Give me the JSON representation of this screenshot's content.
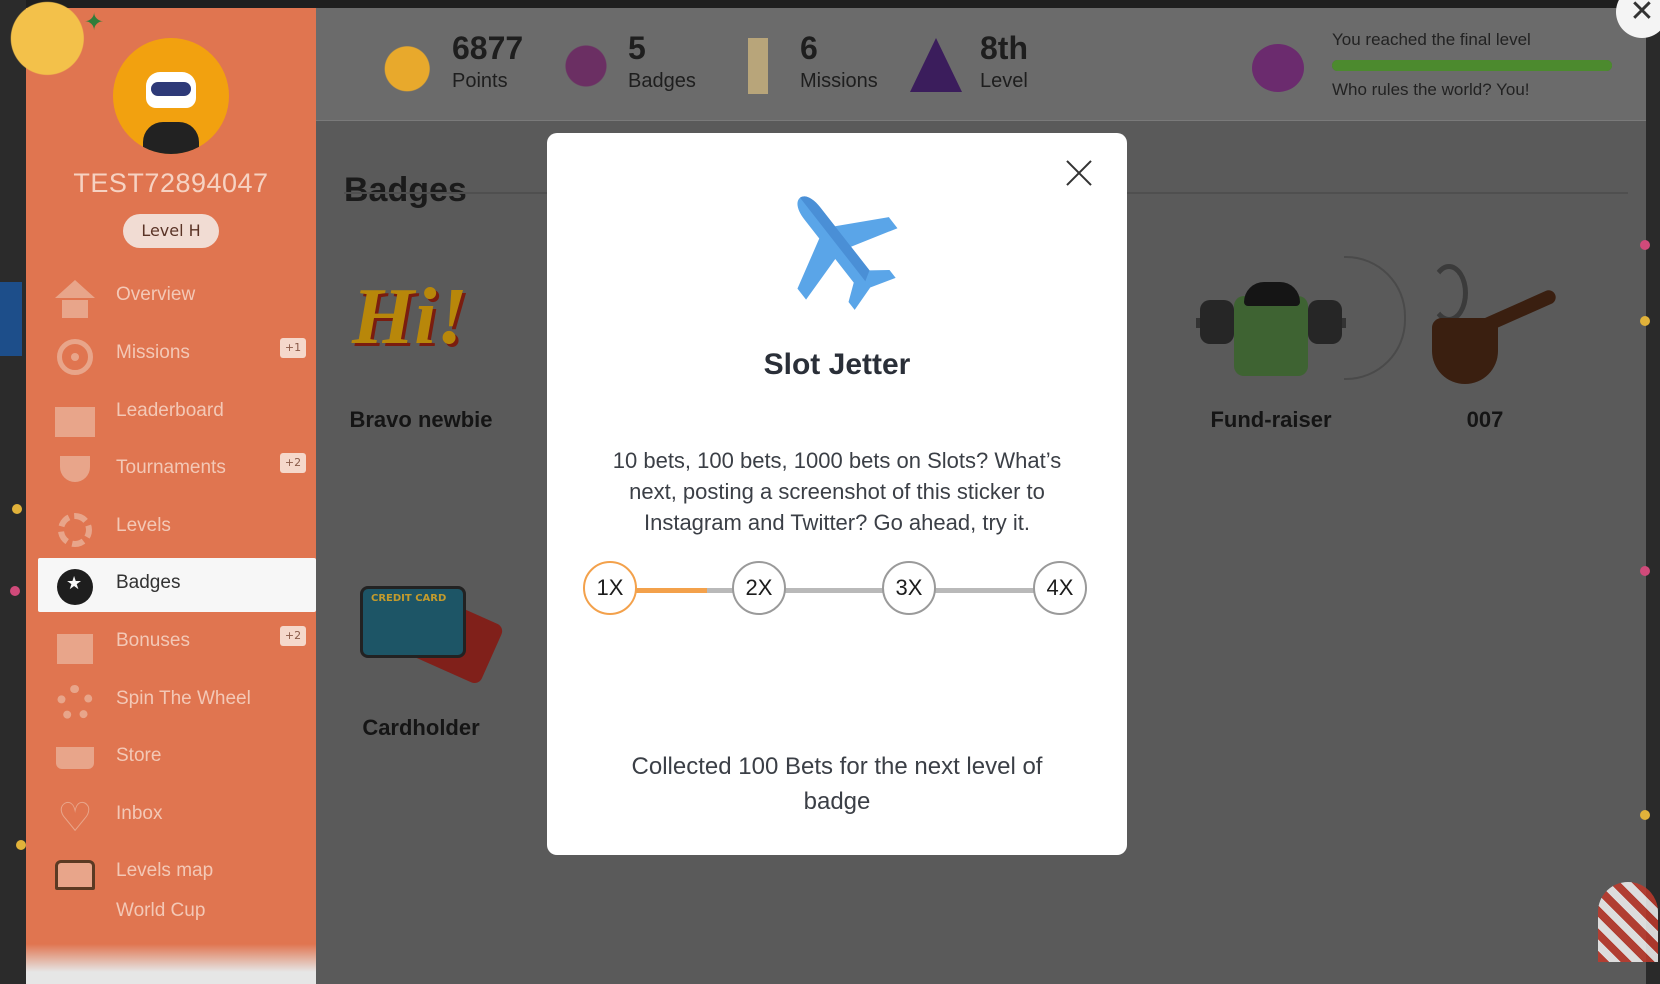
{
  "user": {
    "name": "TEST72894047",
    "level": "Level H"
  },
  "sidebar": {
    "items": [
      {
        "label": "Overview",
        "icon": "home-icon",
        "badge": ""
      },
      {
        "label": "Missions",
        "icon": "target-icon",
        "badge": "+1"
      },
      {
        "label": "Leaderboard",
        "icon": "podium-icon",
        "badge": ""
      },
      {
        "label": "Tournaments",
        "icon": "trophy-icon",
        "badge": "+2"
      },
      {
        "label": "Levels",
        "icon": "star-gear-icon",
        "badge": ""
      },
      {
        "label": "Badges",
        "icon": "medal-icon",
        "badge": "",
        "active": true
      },
      {
        "label": "Bonuses",
        "icon": "gift-icon",
        "badge": "+2"
      },
      {
        "label": "Spin The Wheel",
        "icon": "wheel-icon",
        "badge": ""
      },
      {
        "label": "Store",
        "icon": "cart-icon",
        "badge": ""
      },
      {
        "label": "Inbox",
        "icon": "heartbeat-icon",
        "badge": ""
      },
      {
        "label": "Levels map",
        "icon": "chest-icon",
        "badge": ""
      },
      {
        "label": "World Cup",
        "icon": "flag-icon",
        "badge": ""
      }
    ]
  },
  "stats": [
    {
      "value": "6877",
      "label": "Points",
      "icon": "coins-icon"
    },
    {
      "value": "5",
      "label": "Badges",
      "icon": "gem-icon"
    },
    {
      "value": "6",
      "label": "Missions",
      "icon": "scroll-icon"
    },
    {
      "value": "8th",
      "label": "Level",
      "icon": "wizard-hat-icon"
    }
  ],
  "progress": {
    "message": "You reached the final level",
    "subtext": "Who rules the world? You!",
    "fraction": 1.0
  },
  "page": {
    "title": "Badges"
  },
  "badges": [
    {
      "name": "Bravo newbie",
      "icon": "hi-sticker-icon"
    },
    {
      "name": "Fund-raiser",
      "icon": "money-weightlifter-icon"
    },
    {
      "name": "007",
      "icon": "pipe-icon"
    },
    {
      "name": "Cardholder",
      "icon": "credit-card-icon",
      "card_text": "CREDIT CARD"
    }
  ],
  "modal": {
    "title": "Slot Jetter",
    "icon": "airplane-icon",
    "description": "10 bets, 100 bets, 1000 bets on Slots? What’s next, posting a screenshot of this sticker to Instagram and Twitter? Go ahead, try it.",
    "steps": [
      {
        "label": "1X",
        "active": true
      },
      {
        "label": "2X",
        "active": false
      },
      {
        "label": "3X",
        "active": false
      },
      {
        "label": "4X",
        "active": false
      }
    ],
    "step_progress": 0.64,
    "footer": "Collected 100 Bets for the next level of badge"
  },
  "colors": {
    "sidebar": "#e07550",
    "accent_orange": "#f3a14b",
    "progress_green": "#4c8a2e",
    "plane_blue": "#5aa5e8",
    "overlay": "#5a5a5a"
  }
}
